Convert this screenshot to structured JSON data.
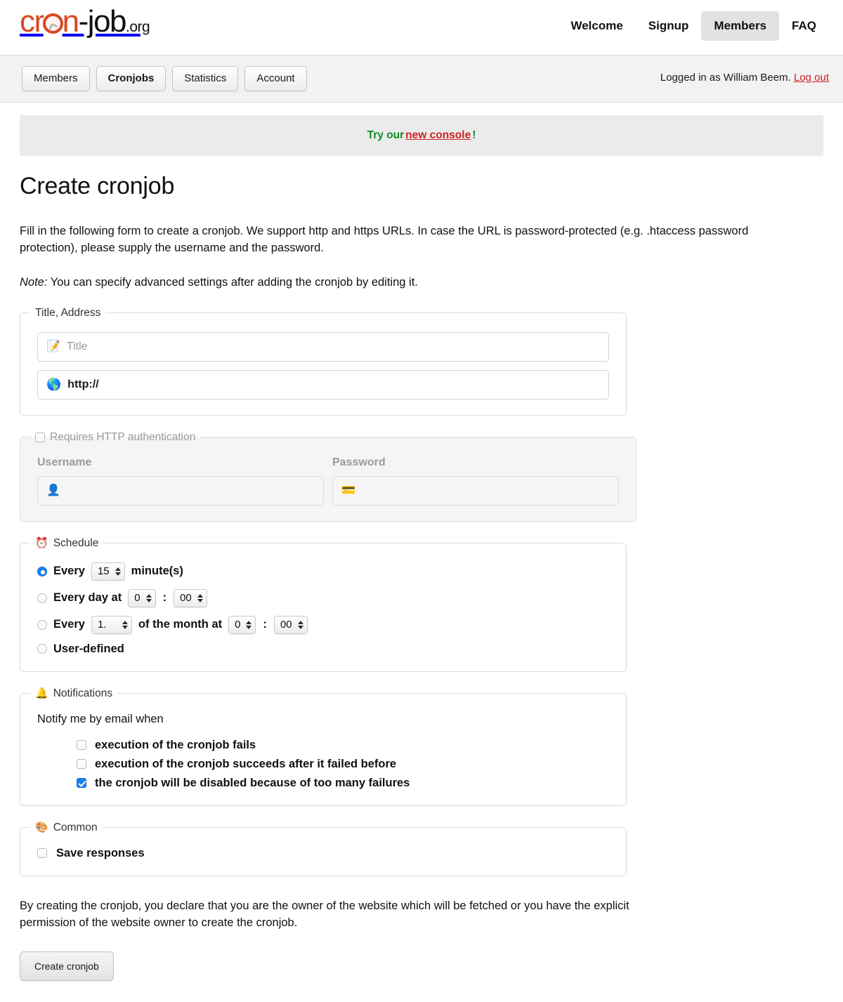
{
  "header": {
    "logo": {
      "part1": "cron",
      "part2": "-job",
      "part3": ".org",
      "clock_icon": "clock-icon"
    },
    "nav": [
      {
        "label": "Welcome",
        "active": false
      },
      {
        "label": "Signup",
        "active": false
      },
      {
        "label": "Members",
        "active": true
      },
      {
        "label": "FAQ",
        "active": false
      }
    ]
  },
  "subnav": {
    "tabs": [
      {
        "label": "Members",
        "active": false
      },
      {
        "label": "Cronjobs",
        "active": true
      },
      {
        "label": "Statistics",
        "active": false
      },
      {
        "label": "Account",
        "active": false
      }
    ],
    "session_text": "Logged in as William Beem.",
    "logout_label": "Log out"
  },
  "banner": {
    "prefix": "Try our ",
    "link": "new console",
    "suffix": "!",
    "green": "#0f8b28",
    "red": "#cc2222"
  },
  "page": {
    "title": "Create cronjob",
    "intro": "Fill in the following form to create a cronjob. We support http and https URLs. In case the URL is password-protected (e.g. .htaccess password protection), please supply the username and the password.",
    "note_label": "Note:",
    "note_text": " You can specify advanced settings after adding the cronjob by editing it.",
    "disclaimer": "By creating the cronjob, you declare that you are the owner of the website which will be fetched or you have the explicit permission of the website owner to create the cronjob.",
    "submit_label": "Create cronjob"
  },
  "title_address": {
    "legend": "Title, Address",
    "title_placeholder": "Title",
    "title_value": "",
    "title_icon": "notepad-icon",
    "url_value": "http://",
    "url_icon": "globe-icon"
  },
  "auth": {
    "legend": "Requires HTTP authentication",
    "checked": false,
    "disabled": true,
    "username_label": "Username",
    "username_value": "",
    "username_icon": "user-icon",
    "password_label": "Password",
    "password_value": "",
    "password_icon": "key-card-icon"
  },
  "schedule": {
    "legend": "Schedule",
    "legend_icon": "alarm-clock-icon",
    "selected": "every_minutes",
    "rows": [
      {
        "id": "every_minutes",
        "selected": true,
        "label_before": "Every",
        "value": "15",
        "label_after": "minute(s)"
      },
      {
        "id": "every_day",
        "selected": false,
        "label_before": "Every day at",
        "hour": "0",
        "minute": "00",
        "separator": ":"
      },
      {
        "id": "every_month",
        "selected": false,
        "label_before": "Every",
        "day": "1.",
        "label_mid": "of the month at",
        "hour": "0",
        "minute": "00",
        "separator": ":"
      },
      {
        "id": "user_defined",
        "selected": false,
        "label_before": "User-defined"
      }
    ]
  },
  "notifications": {
    "legend": "Notifications",
    "legend_icon": "bell-icon",
    "heading": "Notify me by email when",
    "items": [
      {
        "label": "execution of the cronjob fails",
        "checked": false
      },
      {
        "label": "execution of the cronjob succeeds after it failed before",
        "checked": false
      },
      {
        "label": "the cronjob will be disabled because of too many failures",
        "checked": true
      }
    ]
  },
  "common": {
    "legend": "Common",
    "legend_icon": "shapes-icon",
    "save_responses_label": "Save responses",
    "save_responses_checked": false
  }
}
